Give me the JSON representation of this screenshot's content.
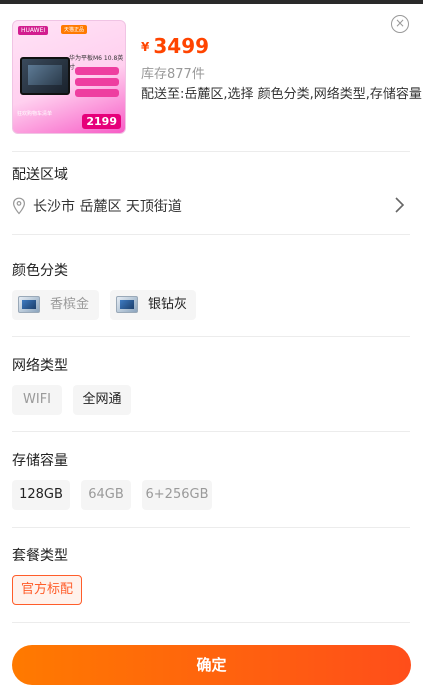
{
  "product": {
    "thumbnail": {
      "brand": "HUAWEI",
      "tag": "天猫正品",
      "model": "华为平板M6 10.8英寸",
      "bottom_text": "狂欢购物车清单",
      "price": "2199"
    },
    "currency_symbol": "¥",
    "price": "3499",
    "stock": "库存877件",
    "delivery": "配送至:岳麓区,选择 颜色分类,网络类型,存储容量"
  },
  "sections": {
    "area": {
      "title": "配送区域",
      "address": "长沙市 岳麓区 天顶街道"
    },
    "color": {
      "title": "颜色分类",
      "options": [
        {
          "label": "香槟金"
        },
        {
          "label": "银钻灰"
        }
      ]
    },
    "network": {
      "title": "网络类型",
      "options": [
        {
          "label": "WIFI"
        },
        {
          "label": "全网通"
        }
      ]
    },
    "storage": {
      "title": "存储容量",
      "options": [
        {
          "label": "128GB"
        },
        {
          "label": "64GB"
        },
        {
          "label": "6+256GB"
        }
      ]
    },
    "package": {
      "title": "套餐类型",
      "options": [
        {
          "label": "官方标配"
        }
      ]
    }
  },
  "actions": {
    "close_glyph": "×",
    "confirm_label": "确定"
  },
  "colors": {
    "accent": "#ff5d2a",
    "price": "#ff4400",
    "confirm_start": "#ff7a00",
    "confirm_end": "#ff4e1a"
  }
}
